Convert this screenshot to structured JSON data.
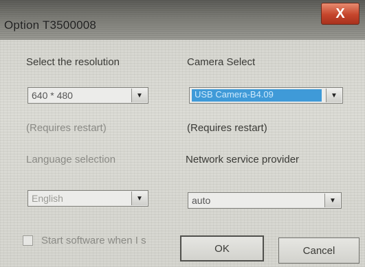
{
  "window": {
    "title": "Option T3500008",
    "close_label": "X"
  },
  "resolution": {
    "label": "Select the resolution",
    "value": "640 * 480",
    "note": "(Requires restart)"
  },
  "camera": {
    "label": "Camera Select",
    "value": "USB Camera-B4.09",
    "note": "(Requires restart)"
  },
  "language": {
    "label": "Language selection",
    "value": "English"
  },
  "network": {
    "label": "Network service provider",
    "value": "auto"
  },
  "startup": {
    "label": "Start software when I s",
    "checked": false
  },
  "buttons": {
    "ok": "OK",
    "cancel": "Cancel"
  },
  "colors": {
    "selection": "#3f9ad8",
    "close": "#c5452c"
  },
  "icons": {
    "dropdown": "chevron-down-icon",
    "close": "close-icon"
  }
}
